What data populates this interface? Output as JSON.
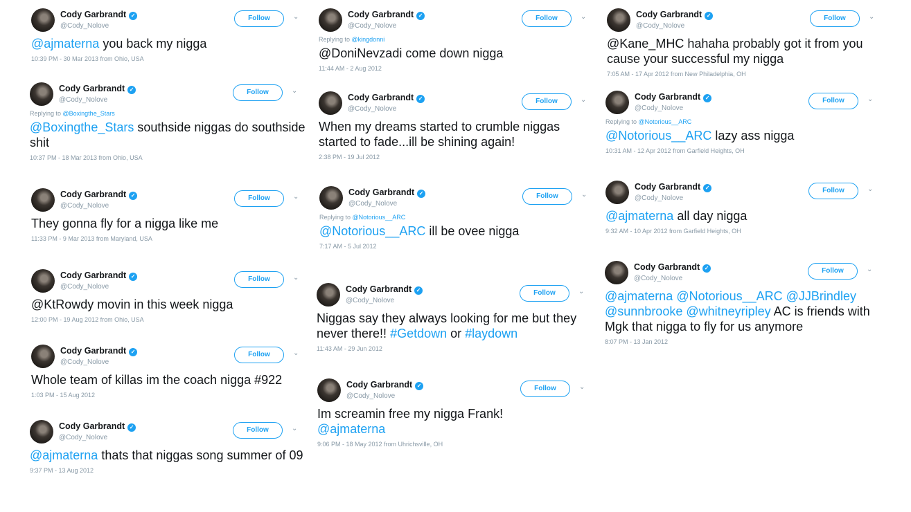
{
  "profile": {
    "name": "Cody Garbrandt",
    "handle": "@Cody_Nolove",
    "follow_label": "Follow"
  },
  "tweets": [
    {
      "reply_label": "",
      "reply_to": "",
      "mention": "@ajmaterna",
      "text": " you back my nigga",
      "extra": "",
      "meta": "10:39 PM - 30 Mar 2013 from Ohio, USA"
    },
    {
      "reply_label": "Replying to ",
      "reply_to": "@Boxingthe_Stars",
      "mention": "@Boxingthe_Stars",
      "text": " southside niggas do southside shit",
      "extra": "",
      "meta": "10:37 PM - 18 Mar 2013 from Ohio, USA"
    },
    {
      "reply_label": "",
      "reply_to": "",
      "mention": "",
      "text": "They gonna fly for a nigga like me",
      "extra": "",
      "meta": "11:33 PM - 9 Mar 2013 from Maryland, USA"
    },
    {
      "reply_label": "",
      "reply_to": "",
      "mention": "",
      "text": "@KtRowdy movin in this week nigga",
      "extra": "",
      "meta": "12:00 PM - 19 Aug 2012 from Ohio, USA"
    },
    {
      "reply_label": "",
      "reply_to": "",
      "mention": "",
      "text": "Whole team of killas im the coach nigga #922",
      "extra": "",
      "meta": "1:03 PM - 15 Aug 2012"
    },
    {
      "reply_label": "",
      "reply_to": "",
      "mention": "@ajmaterna",
      "text": " thats that niggas song summer of 09",
      "extra": "",
      "meta": "9:37 PM - 13 Aug 2012"
    },
    {
      "reply_label": "Replying to ",
      "reply_to": "@kingdonni",
      "mention": "",
      "text": "@DoniNevzadi come down nigga",
      "extra": "",
      "meta": "11:44 AM - 2 Aug 2012"
    },
    {
      "reply_label": "",
      "reply_to": "",
      "mention": "",
      "text": "When my dreams started to crumble niggas started to fade...ill be shining again!",
      "extra": "",
      "meta": "2:38 PM - 19 Jul 2012"
    },
    {
      "reply_label": "Replying to ",
      "reply_to": "@Notorious__ARC",
      "mention": "@Notorious__ARC",
      "text": " ill be ovee nigga",
      "extra": "",
      "meta": "7:17 AM - 5 Jul 2012"
    },
    {
      "reply_label": "",
      "reply_to": "",
      "mention": "",
      "text": "Niggas say they always looking for me but they never there!! ",
      "tag1": "#Getdown",
      "mid": " or ",
      "tag2": "#laydown",
      "meta": "11:43 AM - 29 Jun 2012"
    },
    {
      "reply_label": "",
      "reply_to": "",
      "mention": "",
      "text": "Im screamin free my nigga Frank! ",
      "extra": "@ajmaterna",
      "meta": "9:06 PM - 18 May 2012 from Uhrichsville, OH"
    },
    {
      "reply_label": "",
      "reply_to": "",
      "mention": "",
      "text": "@Kane_MHC hahaha probably got it from you cause your successful my nigga",
      "extra": "",
      "meta": "7:05 AM - 17 Apr 2012 from New Philadelphia, OH"
    },
    {
      "reply_label": "Replying to ",
      "reply_to": "@Notorious__ARC",
      "mention": "@Notorious__ARC",
      "text": " lazy ass nigga",
      "extra": "",
      "meta": "10:31 AM - 12 Apr 2012 from Garfield Heights, OH"
    },
    {
      "reply_label": "",
      "reply_to": "",
      "mention": "@ajmaterna",
      "text": " all day nigga",
      "extra": "",
      "meta": "9:32 AM - 10 Apr 2012 from Garfield Heights, OH"
    },
    {
      "reply_label": "",
      "reply_to": "",
      "mention": "@ajmaterna @Notorious__ARC @JJBrindley @sunnbrooke @whitneyripley",
      "text": " AC is friends with Mgk that nigga to fly for us anymore",
      "extra": "",
      "meta": "8:07 PM - 13 Jan 2012"
    }
  ]
}
